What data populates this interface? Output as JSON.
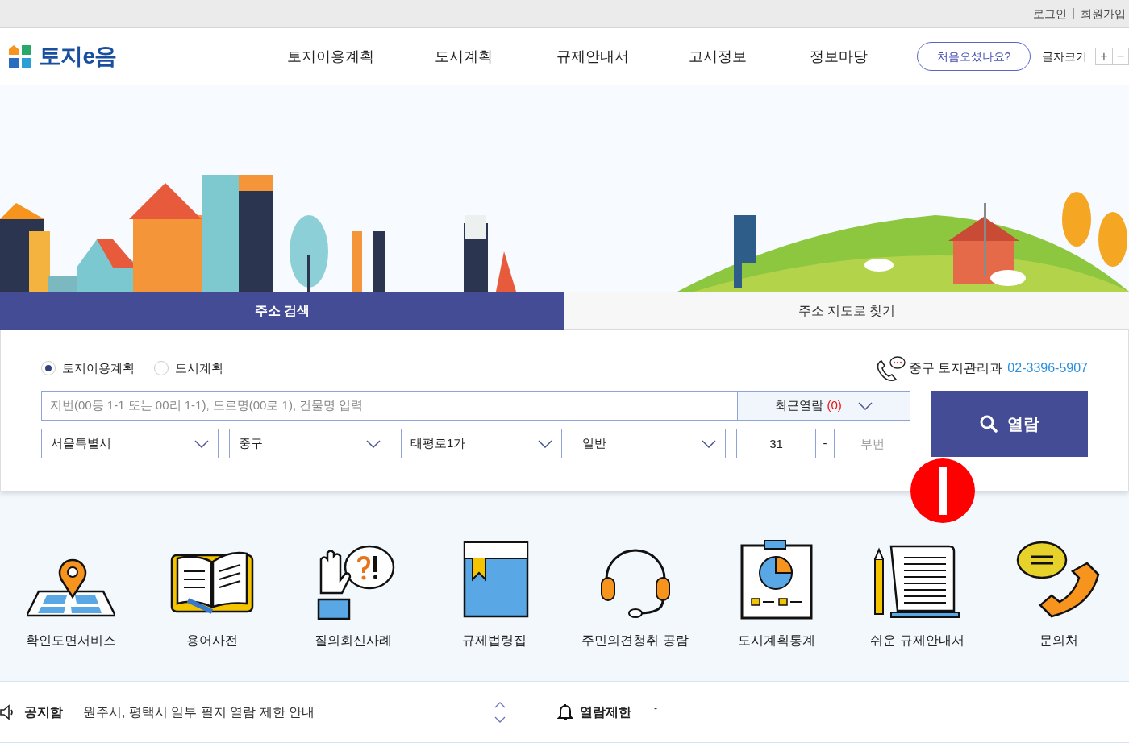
{
  "top_links": [
    "로그인",
    "회원가입"
  ],
  "logo": {
    "text": "토지e음"
  },
  "nav": [
    "토지이용계획",
    "도시계획",
    "규제안내서",
    "고시정보",
    "정보마당"
  ],
  "first_visit_button": "처음오셨나요?",
  "font_size": {
    "label": "글자크기",
    "buttons": [
      "+",
      "−"
    ]
  },
  "search_tabs": [
    {
      "label": "주소 검색",
      "selected": true
    },
    {
      "label": "주소 지도로 찾기",
      "selected": false
    }
  ],
  "radios": [
    {
      "label": "토지이용계획",
      "selected": true
    },
    {
      "label": "도시계획",
      "selected": false
    }
  ],
  "contact": {
    "department": "중구 토지관리과",
    "phone": "02-3396-5907"
  },
  "search_field": {
    "placeholder": "지번(00동 1-1 또는 00리 1-1), 도로명(00로 1), 건물명 입력"
  },
  "recent": {
    "label": "최근열람",
    "count": "(0)"
  },
  "selects": [
    "서울특별시",
    "중구",
    "태평로1가",
    "일반"
  ],
  "main_number": "31",
  "separator": "-",
  "sub_number": {
    "placeholder": "부번"
  },
  "search_button": "열람",
  "quick_links": [
    "확인도면서비스",
    "용어사전",
    "질의회신사례",
    "규제법령집",
    "주민의견청취 공람",
    "도시계획통계",
    "쉬운 규제안내서",
    "문의처"
  ],
  "notice": {
    "label": "공지함",
    "text": "원주시, 평택시 일부 필지 열람 제한 안내"
  },
  "restriction": {
    "label": "열람제한",
    "value": "-"
  }
}
